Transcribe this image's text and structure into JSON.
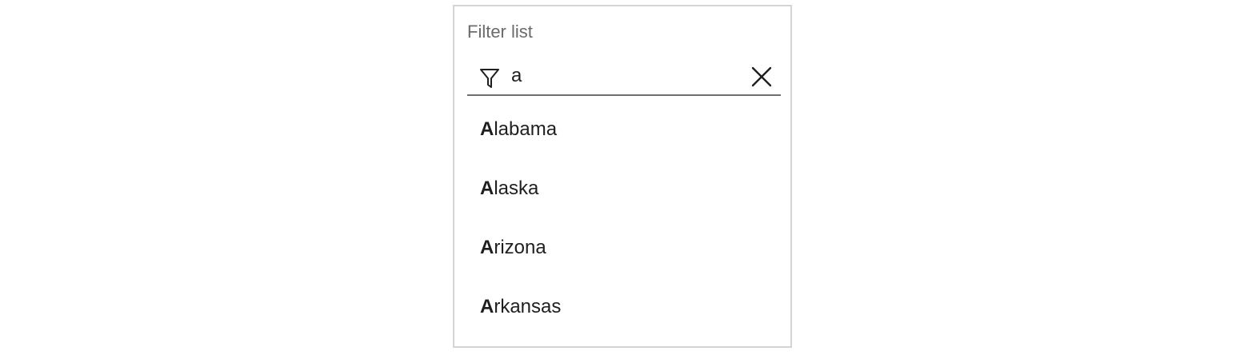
{
  "filter": {
    "label": "Filter list",
    "value": "a",
    "filter_icon": "filter-funnel-icon",
    "clear_icon": "close-x-icon"
  },
  "options": [
    {
      "match": "A",
      "rest": "labama"
    },
    {
      "match": "A",
      "rest": "laska"
    },
    {
      "match": "A",
      "rest": "rizona"
    },
    {
      "match": "A",
      "rest": "rkansas"
    }
  ],
  "colors": {
    "panel_border": "#d4d4d4",
    "label_text": "#6b6b6b",
    "field_underline": "#6e6e6e",
    "text": "#1f1f1f"
  }
}
